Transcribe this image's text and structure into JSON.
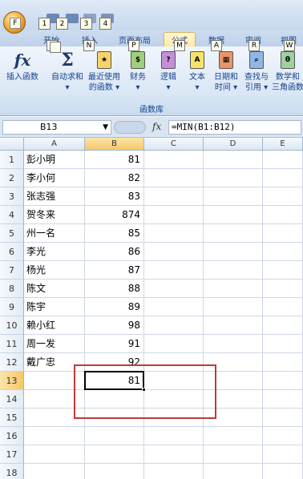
{
  "office": {
    "icon": "office-orb-icon",
    "keytip": "F"
  },
  "quick_access": {
    "keytips": [
      "1",
      "2",
      "3",
      "4"
    ]
  },
  "tabs": [
    {
      "label": "开始",
      "keytip": "H"
    },
    {
      "label": "插入",
      "keytip": "N"
    },
    {
      "label": "页面布局",
      "keytip": "P"
    },
    {
      "label": "公式",
      "keytip": "M"
    },
    {
      "label": "数据",
      "keytip": "A"
    },
    {
      "label": "审阅",
      "keytip": "R"
    },
    {
      "label": "视图",
      "keytip": "W"
    }
  ],
  "active_tab": "公式",
  "ribbon": {
    "group_label": "函数库",
    "buttons": [
      {
        "line1": "插入函数",
        "line2": "",
        "icon": "fx-icon"
      },
      {
        "line1": "自动求和",
        "line2": "▾",
        "icon": "sigma-icon"
      },
      {
        "line1": "最近使用",
        "line2": "的函数 ▾",
        "icon": "recent-book-icon"
      },
      {
        "line1": "财务",
        "line2": "▾",
        "icon": "finance-book-icon"
      },
      {
        "line1": "逻辑",
        "line2": "▾",
        "icon": "logic-book-icon"
      },
      {
        "line1": "文本",
        "line2": "▾",
        "icon": "text-book-icon"
      },
      {
        "line1": "日期和",
        "line2": "时间 ▾",
        "icon": "datetime-book-icon"
      },
      {
        "line1": "查找与",
        "line2": "引用 ▾",
        "icon": "lookup-book-icon"
      },
      {
        "line1": "数学和",
        "line2": "三角函数",
        "icon": "math-book-icon"
      }
    ]
  },
  "formula_bar": {
    "name_box": "B13",
    "fx": "fx",
    "formula": "=MIN(B1:B12)"
  },
  "columns": [
    "A",
    "B",
    "C",
    "D",
    "E"
  ],
  "selected_column": "B",
  "rows": [
    {
      "n": "1",
      "a": "彭小明",
      "b": "81"
    },
    {
      "n": "2",
      "a": "李小何",
      "b": "82"
    },
    {
      "n": "3",
      "a": "张志强",
      "b": "83"
    },
    {
      "n": "4",
      "a": "贺冬来",
      "b": "874"
    },
    {
      "n": "5",
      "a": "州一名",
      "b": "85"
    },
    {
      "n": "6",
      "a": "李光",
      "b": "86"
    },
    {
      "n": "7",
      "a": "杨光",
      "b": "87"
    },
    {
      "n": "8",
      "a": "陈文",
      "b": "88"
    },
    {
      "n": "9",
      "a": "陈宇",
      "b": "89"
    },
    {
      "n": "10",
      "a": "赖小红",
      "b": "98"
    },
    {
      "n": "11",
      "a": "周一发",
      "b": "91"
    },
    {
      "n": "12",
      "a": "戴广忠",
      "b": "92"
    },
    {
      "n": "13",
      "a": "",
      "b": "81"
    },
    {
      "n": "14",
      "a": "",
      "b": ""
    },
    {
      "n": "15",
      "a": "",
      "b": ""
    },
    {
      "n": "16",
      "a": "",
      "b": ""
    },
    {
      "n": "17",
      "a": "",
      "b": ""
    },
    {
      "n": "18",
      "a": "",
      "b": ""
    }
  ],
  "selected_row": "13",
  "colors": {
    "annotation": "#c0393a",
    "selected_header": "#f5c86a",
    "ribbon_text": "#15428b"
  }
}
